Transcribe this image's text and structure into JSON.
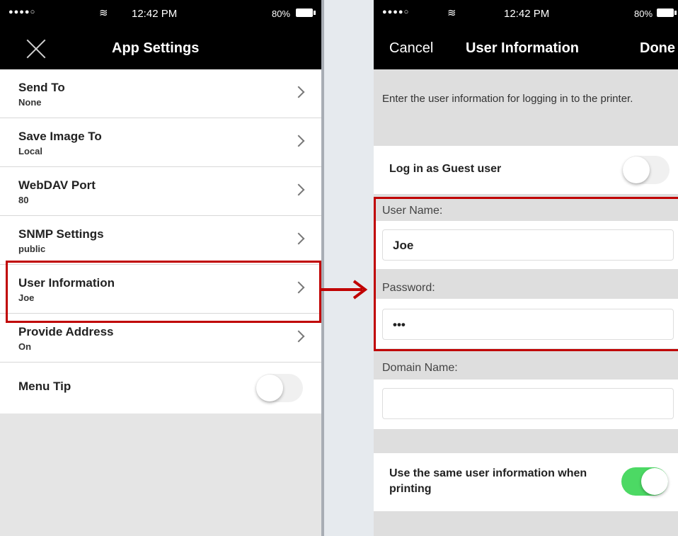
{
  "left": {
    "status": {
      "carrier_dots": "●●●●○",
      "wifi": "≋",
      "time": "12:42 PM",
      "battery": "80%"
    },
    "title": "App Settings",
    "items": [
      {
        "title": "Send To",
        "value": "None"
      },
      {
        "title": "Save Image To",
        "value": "Local"
      },
      {
        "title": "WebDAV Port",
        "value": "80"
      },
      {
        "title": "SNMP Settings",
        "value": "public"
      },
      {
        "title": "User Information",
        "value": "Joe"
      },
      {
        "title": "Provide Address",
        "value": "On"
      }
    ],
    "menu_tip": {
      "label": "Menu Tip",
      "on": false
    }
  },
  "arrow": {
    "color": "#c00000"
  },
  "right": {
    "status": {
      "carrier_dots": "●●●●○",
      "wifi": "≋",
      "time": "12:42 PM",
      "battery": "80%"
    },
    "cancel": "Cancel",
    "title": "User Information",
    "done": "Done",
    "description": "Enter the user information for logging in to the printer.",
    "guest": {
      "label": "Log in as Guest user",
      "on": false
    },
    "username": {
      "label": "User Name:",
      "value": "Joe"
    },
    "password": {
      "label": "Password:",
      "value": "•••"
    },
    "domain": {
      "label": "Domain Name:",
      "value": ""
    },
    "same_info": {
      "label": "Use the same user information when printing",
      "on": true
    }
  },
  "colors": {
    "highlight": "#c00000",
    "toggle_on": "#4cd964"
  }
}
